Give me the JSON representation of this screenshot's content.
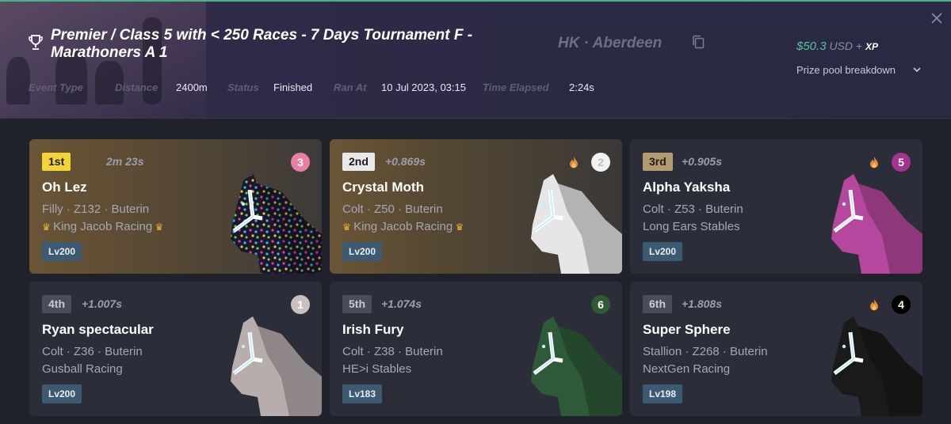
{
  "header": {
    "title": "Premier / Class 5 with < 250 Races - 7 Days Tournament F - Marathoners A 1",
    "location": "HK · Aberdeen",
    "prize": {
      "amount": "$50.3",
      "currency": "USD",
      "plus": "+",
      "xp": "XP"
    },
    "breakdown_label": "Prize pool breakdown",
    "meta": [
      {
        "key": "Event Type",
        "value": ""
      },
      {
        "key": "Distance",
        "value": "2400m"
      },
      {
        "key": "Status",
        "value": "Finished"
      },
      {
        "key": "Ran At",
        "value": "10 Jul 2023, 03:15"
      },
      {
        "key": "Time Elapsed",
        "value": "2:24s"
      }
    ]
  },
  "results": [
    {
      "place": "1st",
      "gap": "2m 23s",
      "name": "Oh Lez",
      "info": "Filly · Z132 · Buterin",
      "stable": "King Jacob Racing",
      "crowned": true,
      "level": "Lv200",
      "gate": "3",
      "gate_color": "#e97fa4",
      "gate_text": "#ffffff",
      "flame": false,
      "coat": "#1a1830",
      "coat_pattern": "spots"
    },
    {
      "place": "2nd",
      "gap": "+0.869s",
      "name": "Crystal Moth",
      "info": "Colt · Z50 · Buterin",
      "stable": "King Jacob Racing",
      "crowned": true,
      "level": "Lv200",
      "gate": "2",
      "gate_color": "#f2f2f2",
      "gate_text": "#bdbdbd",
      "flame": true,
      "coat": "#e6e6e6",
      "coat_pattern": "plain"
    },
    {
      "place": "3rd",
      "gap": "+0.905s",
      "name": "Alpha Yaksha",
      "info": "Colt · Z53 · Buterin",
      "stable": "Long Ears Stables",
      "crowned": false,
      "level": "Lv200",
      "gate": "5",
      "gate_color": "#a3338f",
      "gate_text": "#ffffff",
      "flame": true,
      "coat": "#b6479e",
      "coat_pattern": "plain"
    },
    {
      "place": "4th",
      "gap": "+1.007s",
      "name": "Ryan spectacular",
      "info": "Colt · Z36 · Buterin",
      "stable": "Gusball Racing",
      "crowned": false,
      "level": "Lv200",
      "gate": "1",
      "gate_color": "#cbc0c0",
      "gate_text": "#ffffff",
      "flame": false,
      "coat": "#b8adad",
      "coat_pattern": "plain"
    },
    {
      "place": "5th",
      "gap": "+1.074s",
      "name": "Irish Fury",
      "info": "Colt · Z38 · Buterin",
      "stable": "HE>i Stables",
      "crowned": false,
      "level": "Lv183",
      "gate": "6",
      "gate_color": "#2f5a33",
      "gate_text": "#ffffff",
      "flame": false,
      "coat": "#2f5a38",
      "coat_pattern": "plain"
    },
    {
      "place": "6th",
      "gap": "+1.808s",
      "name": "Super Sphere",
      "info": "Stallion · Z268 · Buterin",
      "stable": "NextGen Racing",
      "crowned": false,
      "level": "Lv198",
      "gate": "4",
      "gate_color": "#000000",
      "gate_text": "#ffffff",
      "flame": true,
      "coat": "#1a1a1a",
      "coat_pattern": "plain"
    }
  ],
  "place_styles": {
    "1st": {
      "bg": "#f3d338",
      "fg": "#1c1c1c"
    },
    "2nd": {
      "bg": "#e9e9ec",
      "fg": "#1c1c1c"
    },
    "3rd": {
      "bg": "#b49a70",
      "fg": "#1c1c1c"
    },
    "other": {
      "bg": "#4a4d58",
      "fg": "#c9cad2"
    }
  }
}
